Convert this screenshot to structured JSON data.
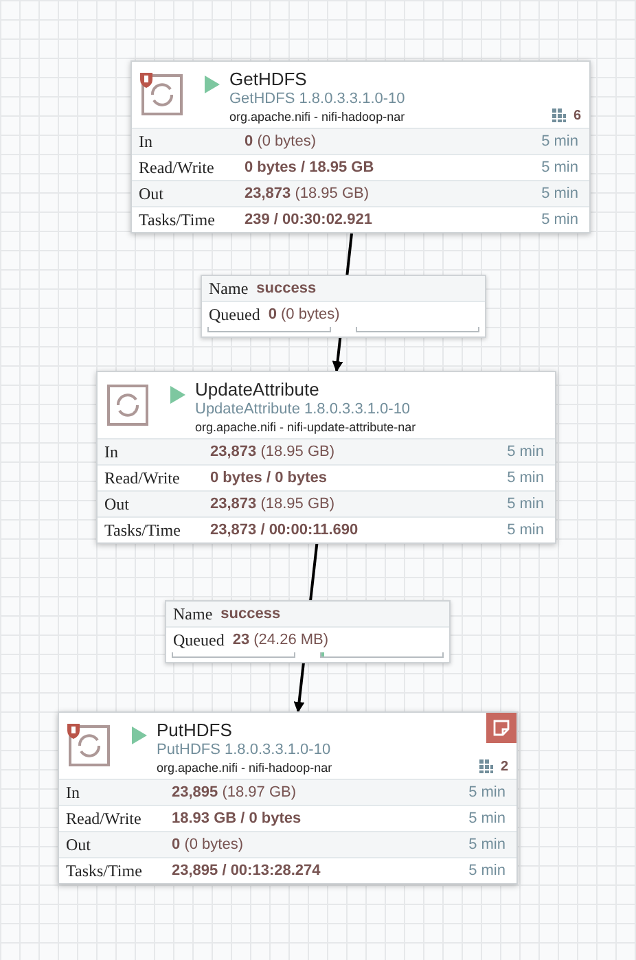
{
  "processors": [
    {
      "name": "GetHDFS",
      "type": "GetHDFS 1.8.0.3.3.1.0-10",
      "bundle": "org.apache.nifi - nifi-hadoop-nar",
      "running": true,
      "restricted": true,
      "bulletin": false,
      "threads": "6",
      "stats": [
        {
          "label": "In",
          "value": "0",
          "detail": "(0 bytes)",
          "time": "5 min"
        },
        {
          "label": "Read/Write",
          "value": "0 bytes / 18.95 GB",
          "time": "5 min"
        },
        {
          "label": "Out",
          "value": "23,873",
          "detail": "(18.95 GB)",
          "time": "5 min"
        },
        {
          "label": "Tasks/Time",
          "value": "239 / 00:30:02.921",
          "time": "5 min"
        }
      ]
    },
    {
      "name": "UpdateAttribute",
      "type": "UpdateAttribute 1.8.0.3.3.1.0-10",
      "bundle": "org.apache.nifi - nifi-update-attribute-nar",
      "running": true,
      "restricted": false,
      "bulletin": false,
      "stats": [
        {
          "label": "In",
          "value": "23,873",
          "detail": "(18.95 GB)",
          "time": "5 min"
        },
        {
          "label": "Read/Write",
          "value": "0 bytes / 0 bytes",
          "time": "5 min"
        },
        {
          "label": "Out",
          "value": "23,873",
          "detail": "(18.95 GB)",
          "time": "5 min"
        },
        {
          "label": "Tasks/Time",
          "value": "23,873 / 00:00:11.690",
          "time": "5 min"
        }
      ]
    },
    {
      "name": "PutHDFS",
      "type": "PutHDFS 1.8.0.3.3.1.0-10",
      "bundle": "org.apache.nifi - nifi-hadoop-nar",
      "running": true,
      "restricted": true,
      "bulletin": true,
      "threads": "2",
      "stats": [
        {
          "label": "In",
          "value": "23,895",
          "detail": "(18.97 GB)",
          "time": "5 min"
        },
        {
          "label": "Read/Write",
          "value": "18.93 GB / 0 bytes",
          "time": "5 min"
        },
        {
          "label": "Out",
          "value": "0",
          "detail": "(0 bytes)",
          "time": "5 min"
        },
        {
          "label": "Tasks/Time",
          "value": "23,895 / 00:13:28.274",
          "time": "5 min"
        }
      ]
    }
  ],
  "connections": [
    {
      "name_label": "Name",
      "name": "success",
      "queued_label": "Queued",
      "queued": "0",
      "queued_detail": "(0 bytes)"
    },
    {
      "name_label": "Name",
      "name": "success",
      "queued_label": "Queued",
      "queued": "23",
      "queued_detail": "(24.26 MB)",
      "size_bar": {
        "level": 0.02
      }
    }
  ]
}
